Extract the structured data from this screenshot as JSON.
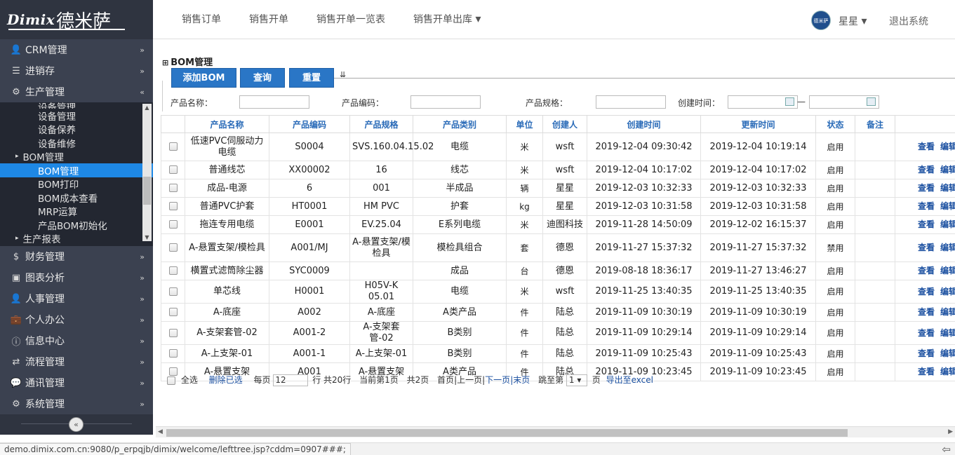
{
  "sidebar": {
    "logo": {
      "brand": "Dimix",
      "cn": "德米萨"
    },
    "menu_top": [
      {
        "icon": "user-icon",
        "glyph": "👤",
        "label": "CRM管理",
        "chev": "»"
      },
      {
        "icon": "list-icon",
        "glyph": "☰",
        "label": "进销存",
        "chev": "»"
      },
      {
        "icon": "gear-icon",
        "glyph": "⚙",
        "label": "生产管理",
        "chev": "«"
      }
    ],
    "submenu": {
      "cut_top": "设备管理",
      "items": [
        {
          "label": "设备管理"
        },
        {
          "label": "设备保养"
        },
        {
          "label": "设备维修"
        },
        {
          "label": "BOM管理",
          "tri": "▸"
        },
        {
          "label": "BOM管理"
        },
        {
          "label": "BOM打印"
        },
        {
          "label": "BOM成本查看"
        },
        {
          "label": "MRP运算"
        },
        {
          "label": "产品BOM初始化"
        },
        {
          "label": "生产报表",
          "tri": "▸"
        }
      ]
    },
    "menu_bottom": [
      {
        "icon": "dollar-icon",
        "glyph": "$",
        "label": "财务管理",
        "chev": "»"
      },
      {
        "icon": "image-icon",
        "glyph": "▣",
        "label": "图表分析",
        "chev": "»"
      },
      {
        "icon": "person-icon",
        "glyph": "👤",
        "label": "人事管理",
        "chev": "»"
      },
      {
        "icon": "briefcase-icon",
        "glyph": "💼",
        "label": "个人办公",
        "chev": "»"
      },
      {
        "icon": "info-icon",
        "glyph": "ⓘ",
        "label": "信息中心",
        "chev": "»"
      },
      {
        "icon": "exchange-icon",
        "glyph": "⇄",
        "label": "流程管理",
        "chev": "»"
      },
      {
        "icon": "comment-icon",
        "glyph": "💬",
        "label": "通讯管理",
        "chev": "»"
      },
      {
        "icon": "cog-icon",
        "glyph": "⚙",
        "label": "系统管理",
        "chev": "»"
      }
    ],
    "collapse": "«"
  },
  "topnav": {
    "links": [
      "销售订单",
      "销售开单",
      "销售开单一览表",
      "销售开单出库"
    ],
    "dropdown_caret": "▾",
    "avatar_text": "德米萨",
    "user": "星星",
    "logout": "退出系统"
  },
  "page": {
    "title": "BOM管理",
    "buttons": {
      "add": "添加BOM",
      "query": "查询",
      "reset": "重置",
      "toggle": "⇊"
    },
    "filters": {
      "name_label": "产品名称：",
      "code_label": "产品编码：",
      "spec_label": "产品规格：",
      "time_label": "创建时间：",
      "dash": "—"
    }
  },
  "table": {
    "headers": [
      "",
      "产品名称",
      "产品编码",
      "产品规格",
      "产品类别",
      "单位",
      "创建人",
      "创建时间",
      "更新时间",
      "状态",
      "备注",
      ""
    ],
    "rows": [
      {
        "name": "低速PVC伺服动力电缆",
        "code": "S0004",
        "spec": "SVS.160.04.15.02",
        "cat": "电缆",
        "unit": "米",
        "creator": "wsft",
        "created": "2019-12-04 09:30:42",
        "updated": "2019-12-04 10:19:14",
        "status": "启用",
        "note": "",
        "tall": true
      },
      {
        "name": "普通线芯",
        "code": "XX00002",
        "spec": "16",
        "cat": "线芯",
        "unit": "米",
        "creator": "wsft",
        "created": "2019-12-04 10:17:02",
        "updated": "2019-12-04 10:17:02",
        "status": "启用",
        "note": ""
      },
      {
        "name": "成品-电源",
        "code": "6",
        "spec": "001",
        "cat": "半成品",
        "unit": "辆",
        "creator": "星星",
        "created": "2019-12-03 10:32:33",
        "updated": "2019-12-03 10:32:33",
        "status": "启用",
        "note": ""
      },
      {
        "name": "普通PVC护套",
        "code": "HT0001",
        "spec": "HM PVC",
        "cat": "护套",
        "unit": "kg",
        "creator": "星星",
        "created": "2019-12-03 10:31:58",
        "updated": "2019-12-03 10:31:58",
        "status": "启用",
        "note": ""
      },
      {
        "name": "拖连专用电缆",
        "code": "E0001",
        "spec": "EV.25.04",
        "cat": "E系列电缆",
        "unit": "米",
        "creator": "迪图科技",
        "created": "2019-11-28 14:50:09",
        "updated": "2019-12-02 16:15:37",
        "status": "启用",
        "note": ""
      },
      {
        "name": "A-悬置支架/模检具",
        "code": "A001/MJ",
        "spec": "A-悬置支架/模检具",
        "cat": "模检具组合",
        "unit": "套",
        "creator": "德恩",
        "created": "2019-11-27 15:37:32",
        "updated": "2019-11-27 15:37:32",
        "status": "禁用",
        "note": "",
        "tall": true
      },
      {
        "name": "横置式滤筒除尘器",
        "code": "SYC0009",
        "spec": "",
        "cat": "成品",
        "unit": "台",
        "creator": "德恩",
        "created": "2019-08-18 18:36:17",
        "updated": "2019-11-27 13:46:27",
        "status": "启用",
        "note": ""
      },
      {
        "name": "单芯线",
        "code": "H0001",
        "spec": "H05V-K 05.01",
        "cat": "电缆",
        "unit": "米",
        "creator": "wsft",
        "created": "2019-11-25 13:40:35",
        "updated": "2019-11-25 13:40:35",
        "status": "启用",
        "note": ""
      },
      {
        "name": "A-底座",
        "code": "A002",
        "spec": "A-底座",
        "cat": "A类产品",
        "unit": "件",
        "creator": "陆总",
        "created": "2019-11-09 10:30:19",
        "updated": "2019-11-09 10:30:19",
        "status": "启用",
        "note": ""
      },
      {
        "name": "A-支架套管-02",
        "code": "A001-2",
        "spec": "A-支架套管-02",
        "cat": "B类别",
        "unit": "件",
        "creator": "陆总",
        "created": "2019-11-09 10:29:14",
        "updated": "2019-11-09 10:29:14",
        "status": "启用",
        "note": ""
      },
      {
        "name": "A-上支架-01",
        "code": "A001-1",
        "spec": "A-上支架-01",
        "cat": "B类别",
        "unit": "件",
        "creator": "陆总",
        "created": "2019-11-09 10:25:43",
        "updated": "2019-11-09 10:25:43",
        "status": "启用",
        "note": ""
      },
      {
        "name": "A-悬置支架",
        "code": "A001",
        "spec": "A-悬置支架",
        "cat": "A类产品",
        "unit": "件",
        "creator": "陆总",
        "created": "2019-11-09 10:23:45",
        "updated": "2019-11-09 10:23:45",
        "status": "启用",
        "note": ""
      }
    ],
    "actions": {
      "view": "查看",
      "edit": "编辑"
    }
  },
  "pager": {
    "select_all": "全选",
    "delete_selected": "删除已选",
    "per_page_prefix": "每页",
    "per_page_value": "12",
    "per_page_suffix": "行 共20行",
    "current": "当前第1页",
    "total_pages": "共2页",
    "first": "首页",
    "sep": "|",
    "prev": "上一页",
    "next": "下一页",
    "last": "末页",
    "jump_prefix": "跳至第",
    "jump_value": "1 ▾",
    "jump_suffix": "页",
    "export": "导出至excel"
  },
  "statusbar": {
    "url": "demo.dimix.com.cn:9080/p_erpqjb/dimix/welcome/lefttree.jsp?cddm=0907###;",
    "back_glyph": "⇦"
  },
  "colors": {
    "accent": "#2a76c6",
    "sidebar": "#3b4150",
    "active": "#1e88e5",
    "link": "#1a4fa0"
  }
}
